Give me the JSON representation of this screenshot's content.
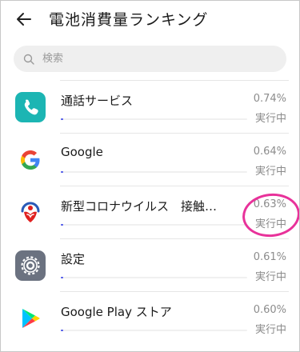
{
  "header": {
    "title": "電池消費量ランキング",
    "back_icon": "arrow-left-icon"
  },
  "search": {
    "placeholder": "検索",
    "value": "",
    "icon": "search-icon"
  },
  "apps": [
    {
      "name": "通話サービス",
      "percent": "0.74%",
      "status": "実行中",
      "icon": "phone-icon",
      "usage_fraction": 0.012
    },
    {
      "name": "Google",
      "percent": "0.64%",
      "status": "実行中",
      "icon": "google-icon",
      "usage_fraction": 0.01
    },
    {
      "name": "新型コロナウイルス　接触確認アプリ",
      "percent": "0.63%",
      "status": "実行中",
      "icon": "cocoa-app-icon",
      "usage_fraction": 0.01
    },
    {
      "name": "設定",
      "percent": "0.61%",
      "status": "実行中",
      "icon": "settings-gear-icon",
      "usage_fraction": 0.01
    },
    {
      "name": "Google Play ストア",
      "percent": "0.60%",
      "status": "実行中",
      "icon": "google-play-icon",
      "usage_fraction": 0.01
    }
  ],
  "colors": {
    "accent": "#4a55e8",
    "phone_app": "#1cb5b3",
    "settings_app": "#6b7280",
    "highlight_marker": "#e8329a"
  }
}
